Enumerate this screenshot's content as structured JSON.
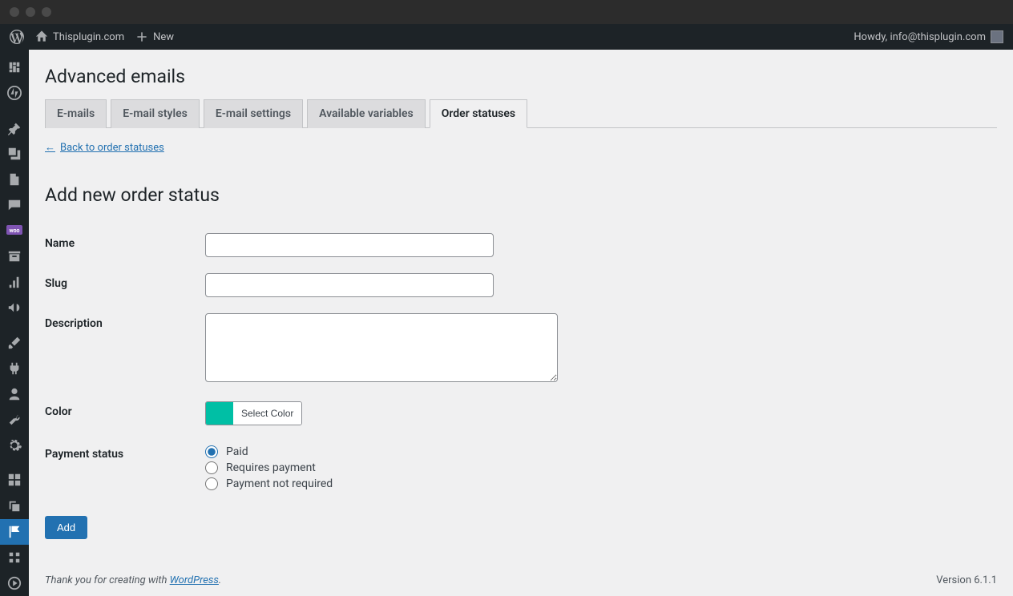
{
  "adminbar": {
    "site_name": "Thisplugin.com",
    "new_label": "New",
    "greeting": "Howdy, info@thisplugin.com"
  },
  "page": {
    "title": "Advanced emails",
    "tabs": [
      {
        "label": "E-mails"
      },
      {
        "label": "E-mail styles"
      },
      {
        "label": "E-mail settings"
      },
      {
        "label": "Available variables"
      },
      {
        "label": "Order statuses"
      }
    ],
    "back_link": "Back to order statuses",
    "section_title": "Add new order status"
  },
  "form": {
    "name_label": "Name",
    "slug_label": "Slug",
    "description_label": "Description",
    "color_label": "Color",
    "color_value": "#00bfa5",
    "select_color_btn": "Select Color",
    "payment_status_label": "Payment status",
    "payment_options": {
      "paid": "Paid",
      "requires": "Requires payment",
      "not_required": "Payment not required"
    },
    "submit_label": "Add"
  },
  "footer": {
    "thanks_prefix": "Thank you for creating with ",
    "wp_link": "WordPress",
    "thanks_suffix": ".",
    "version": "Version 6.1.1"
  }
}
